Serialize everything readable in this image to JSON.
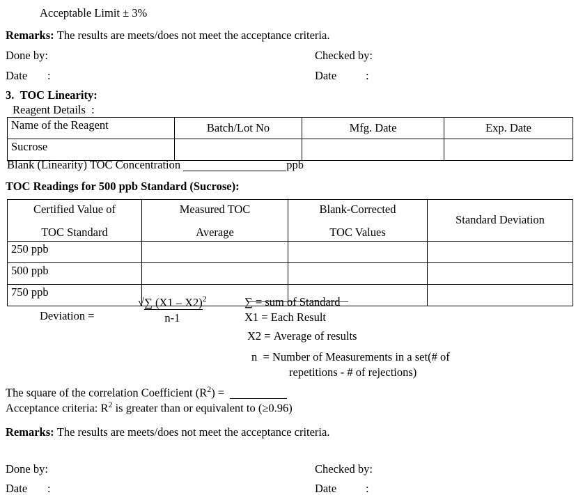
{
  "document": {
    "top_note": "Acceptable Limit ± 3%",
    "remarks_top": {
      "label": "Remarks:",
      "text": "The results are meets/does not meet the acceptance criteria."
    },
    "signoff_top": {
      "done_by": "Done by:",
      "checked_by": "Checked by:",
      "date_left": "Date",
      "date_left_colon": ":",
      "date_right": "Date",
      "date_right_colon": ":"
    },
    "section": {
      "number": "3.",
      "title": "TOC Linearity:",
      "reagent_details_label": "Reagent Details",
      "reagent_details_colon": ":"
    },
    "reagent_table": {
      "headers": [
        "Name of the Reagent",
        "Batch/Lot No",
        "Mfg. Date",
        "Exp. Date"
      ],
      "rows": [
        [
          "Sucrose",
          "",
          "",
          ""
        ]
      ]
    },
    "blank_concentration": {
      "label": "Blank (Linearity) TOC Concentration",
      "value": "",
      "unit": "ppb"
    },
    "readings_heading": "TOC Readings for 500 ppb Standard (Sucrose):",
    "readings_table": {
      "headers": [
        {
          "line1": "Certified Value of",
          "line2": "TOC Standard"
        },
        {
          "line1": "Measured TOC",
          "line2": "Average"
        },
        {
          "line1": "Blank-Corrected",
          "line2": "TOC Values"
        },
        {
          "line1": "Standard Deviation",
          "line2": ""
        }
      ],
      "rows": [
        [
          "250 ppb",
          "",
          "",
          ""
        ],
        [
          "500 ppb",
          "",
          "",
          ""
        ],
        [
          "750 ppb",
          "",
          "",
          ""
        ]
      ]
    },
    "formula": {
      "label": "Deviation  =",
      "radical": "√",
      "numerator": "∑ (X1 – X2)",
      "numerator_exponent": "2",
      "denominator": "n-1",
      "legend": [
        {
          "symbol": "∑",
          "equals": "=",
          "definition": "sum of Standard"
        },
        {
          "symbol": "X1",
          "equals": "=",
          "definition": "Each Result"
        },
        {
          "symbol": "X2",
          "equals": "=",
          "definition": "Average of results"
        },
        {
          "symbol": "n",
          "equals": "=",
          "definition": "Number of Measurements in a set(# of"
        },
        {
          "symbol": "",
          "equals": "",
          "definition": "repetitions - # of rejections)"
        }
      ]
    },
    "correlation": {
      "label_pre": "The square of the correlation Coefficient (R",
      "label_sup": "2",
      "label_post": ") =",
      "value": "",
      "criteria_pre": "Acceptance criteria: R",
      "criteria_sup": "2",
      "criteria_post": " is greater than or equivalent to (≥0.96)"
    },
    "remarks_bottom": {
      "label": "Remarks:",
      "text": "The results are meets/does not meet the acceptance criteria."
    },
    "signoff_bottom": {
      "done_by": "Done by:",
      "checked_by": "Checked by:",
      "date_left": "Date",
      "date_left_colon": ":",
      "date_right": "Date",
      "date_right_colon": ":"
    }
  }
}
